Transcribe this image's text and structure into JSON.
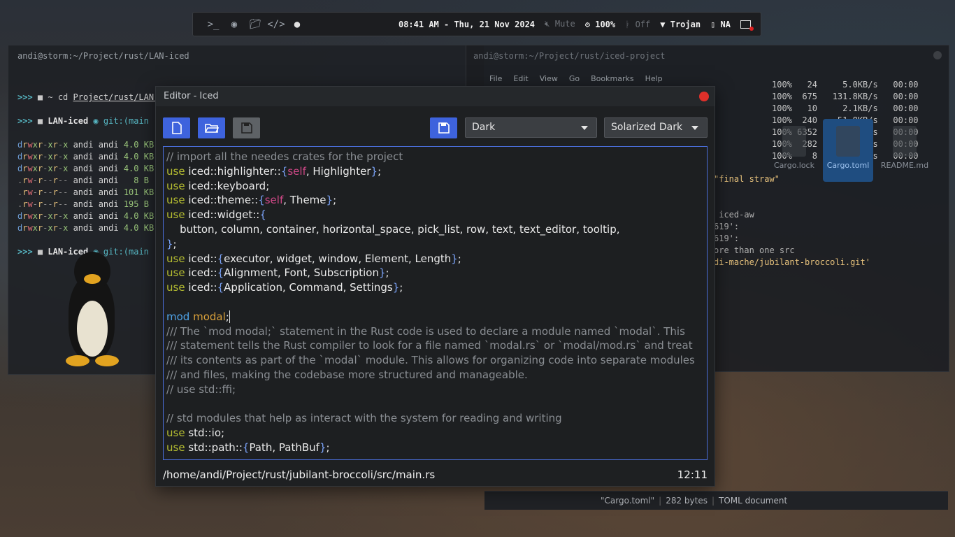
{
  "statusbar": {
    "launchers": [
      "terminal-icon",
      "chrome-icon",
      "folder-icon",
      "code-icon",
      "chat-icon"
    ],
    "clock": "08:41 AM - Thu, 21 Nov 2024",
    "volume": "Mute",
    "brightness": "100%",
    "bluetooth": "Off",
    "wifi": "Trojan",
    "battery": "NA"
  },
  "term_left": {
    "title": "andi@storm:~/Project/rust/LAN-iced",
    "cmd_path": "Project/rust/LAN-i",
    "prompt_dir": "LAN-iced",
    "git": "git:(main",
    "listing": [
      {
        "perm": "drwxr-xr-x",
        "user": "andi",
        "group": "andi",
        "size": "4.0 KB"
      },
      {
        "perm": "drwxr-xr-x",
        "user": "andi",
        "group": "andi",
        "size": "4.0 KB"
      },
      {
        "perm": "drwxr-xr-x",
        "user": "andi",
        "group": "andi",
        "size": "4.0 KB"
      },
      {
        "perm": ".rw-r--r--",
        "user": "andi",
        "group": "andi",
        "size": "  8 B"
      },
      {
        "perm": ".rw-r--r--",
        "user": "andi",
        "group": "andi",
        "size": "101 KB"
      },
      {
        "perm": ".rw-r--r--",
        "user": "andi",
        "group": "andi",
        "size": "195 B"
      },
      {
        "perm": "drwxr-xr-x",
        "user": "andi",
        "group": "andi",
        "size": "4.0 KB"
      },
      {
        "perm": "drwxr-xr-x",
        "user": "andi",
        "group": "andi",
        "size": "4.0 KB"
      }
    ]
  },
  "term_right": {
    "title": "andi@storm:~/Project/rust/iced-project",
    "menu": [
      "File",
      "Edit",
      "View",
      "Go",
      "Bookmarks",
      "Help"
    ],
    "netstat": [
      "100%   24     5.0KB/s   00:00",
      "100%  675   131.8KB/s   00:00",
      "100%   10     2.1KB/s   00:00",
      "100%  240    51.8KB/s   00:00",
      "100% 6352     1.0MB/s   00:00",
      "100%  282    60.5KB/s   00:00",
      "100%    8     1.9KB/s   00:00"
    ],
    "files": [
      "Cargo.lock",
      "Cargo.toml",
      "README.md"
    ],
    "text_lines": [
      "\"final straw\"",
      "",
      "",
      " iced-aw",
      "619':",
      "619':",
      "ore than one src",
      "di-mache/jubilant-broccoli.git'"
    ],
    "status": {
      "file": "\"Cargo.toml\"",
      "size": "282 bytes",
      "kind": "TOML document"
    }
  },
  "editor": {
    "title": "Editor - Iced",
    "theme": "Dark",
    "highlight_theme": "Solarized Dark",
    "file_path": "/home/andi/Project/rust/jubilant-broccoli/src/main.rs",
    "cursor_pos": "12:11",
    "code": [
      [
        [
          "c-com",
          "// import all the needes crates for the project"
        ]
      ],
      [
        [
          "c-kw",
          "use"
        ],
        [
          "",
          "iced::highlighter::"
        ],
        [
          "c-br",
          "{"
        ],
        [
          "c-self",
          "self"
        ],
        [
          "",
          ", Highlighter"
        ],
        [
          "c-br",
          "}"
        ],
        [
          "",
          ";"
        ]
      ],
      [
        [
          "c-kw",
          "use"
        ],
        [
          "",
          "iced::keyboard;"
        ]
      ],
      [
        [
          "c-kw",
          "use"
        ],
        [
          "",
          "iced::theme::"
        ],
        [
          "c-br",
          "{"
        ],
        [
          "c-self",
          "self"
        ],
        [
          "",
          ", Theme"
        ],
        [
          "c-br",
          "}"
        ],
        [
          "",
          ";"
        ]
      ],
      [
        [
          "c-kw",
          "use"
        ],
        [
          "",
          "iced::widget::"
        ],
        [
          "c-br",
          "{"
        ]
      ],
      [
        [
          "",
          "    button, column, container, horizontal_space, pick_list, row, text, text_editor, tooltip,"
        ]
      ],
      [
        [
          "c-br",
          "}"
        ],
        [
          "",
          ";"
        ]
      ],
      [
        [
          "c-kw",
          "use"
        ],
        [
          "",
          "iced::"
        ],
        [
          "c-br",
          "{"
        ],
        [
          "",
          "executor, widget, window, Element, Length"
        ],
        [
          "c-br",
          "}"
        ],
        [
          "",
          ";"
        ]
      ],
      [
        [
          "c-kw",
          "use"
        ],
        [
          "",
          "iced::"
        ],
        [
          "c-br",
          "{"
        ],
        [
          "",
          "Alignment, Font, Subscription"
        ],
        [
          "c-br",
          "}"
        ],
        [
          "",
          ";"
        ]
      ],
      [
        [
          "c-kw",
          "use"
        ],
        [
          "",
          "iced::"
        ],
        [
          "c-br",
          "{"
        ],
        [
          "",
          "Application, Command, Settings"
        ],
        [
          "c-br",
          "}"
        ],
        [
          "",
          ";"
        ]
      ],
      [
        [
          "",
          ""
        ]
      ],
      [
        [
          "c-mod",
          "mod"
        ],
        [
          "c-name",
          "modal"
        ],
        [
          "",
          ";"
        ]
      ],
      [
        [
          "c-com",
          "/// The `mod modal;` statement in the Rust code is used to declare a module named `modal`. This"
        ]
      ],
      [
        [
          "c-com",
          "/// statement tells the Rust compiler to look for a file named `modal.rs` or `modal/mod.rs` and treat"
        ]
      ],
      [
        [
          "c-com",
          "/// its contents as part of the `modal` module. This allows for organizing code into separate modules"
        ]
      ],
      [
        [
          "c-com",
          "/// and files, making the codebase more structured and manageable."
        ]
      ],
      [
        [
          "c-com",
          "// use std::ffi;"
        ]
      ],
      [
        [
          "",
          ""
        ]
      ],
      [
        [
          "c-com",
          "// std modules that help as interact with the system for reading and writing"
        ]
      ],
      [
        [
          "c-kw",
          "use"
        ],
        [
          "",
          "std::io;"
        ]
      ],
      [
        [
          "c-kw",
          "use"
        ],
        [
          "",
          "std::path::"
        ],
        [
          "c-br",
          "{"
        ],
        [
          "",
          "Path, PathBuf"
        ],
        [
          "c-br",
          "}"
        ],
        [
          "",
          ";"
        ]
      ]
    ]
  }
}
